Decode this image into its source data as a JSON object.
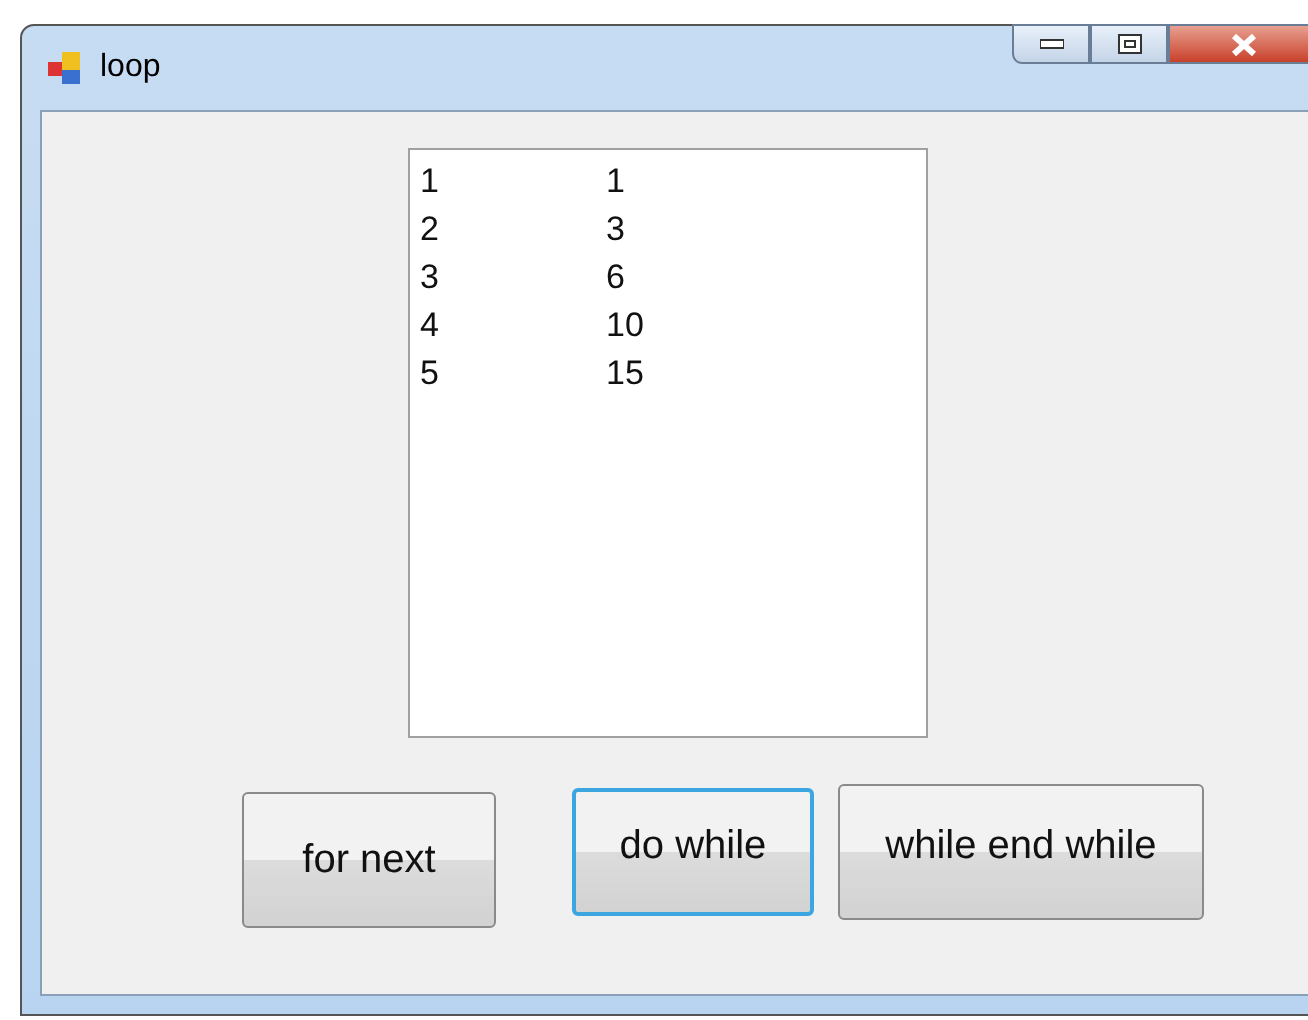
{
  "window": {
    "title": "loop"
  },
  "listbox": {
    "rows": [
      {
        "column_1": "1",
        "column_2": "1"
      },
      {
        "column_1": "2",
        "column_2": "3"
      },
      {
        "column_1": "3",
        "column_2": "6"
      },
      {
        "column_1": "4",
        "column_2": "10"
      },
      {
        "column_1": "5",
        "column_2": "15"
      }
    ]
  },
  "buttons": [
    {
      "label": "for next",
      "focused": false
    },
    {
      "label": "do while",
      "focused": true
    },
    {
      "label": "while end while",
      "focused": false
    }
  ]
}
